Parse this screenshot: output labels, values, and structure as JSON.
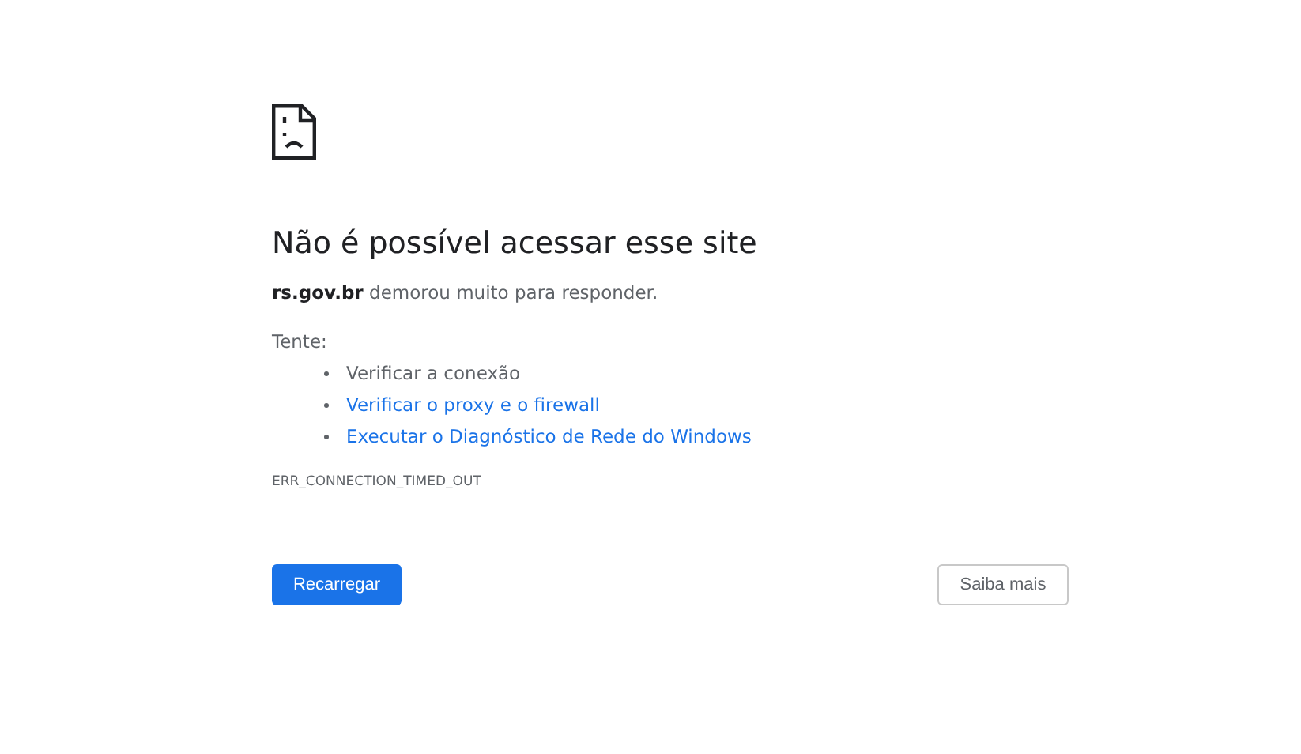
{
  "error_page": {
    "title": "Não é possível acessar esse site",
    "message": "**rs.gov.br** demorou muito para responder.",
    "try_label": "Tente:",
    "suggestions": [
      {
        "kind": "text",
        "label": "Verificar a conexão"
      },
      {
        "kind": "link",
        "label": "Verificar o proxy e o firewall"
      },
      {
        "kind": "link",
        "label": "Executar o Diagnóstico de Rede do Windows"
      }
    ],
    "error_code": "ERR_CONNECTION_TIMED_OUT",
    "buttons": [
      {
        "kind": "primary",
        "label": "Recarregar"
      },
      {
        "kind": "secondary",
        "label": "Saiba mais"
      }
    ]
  }
}
